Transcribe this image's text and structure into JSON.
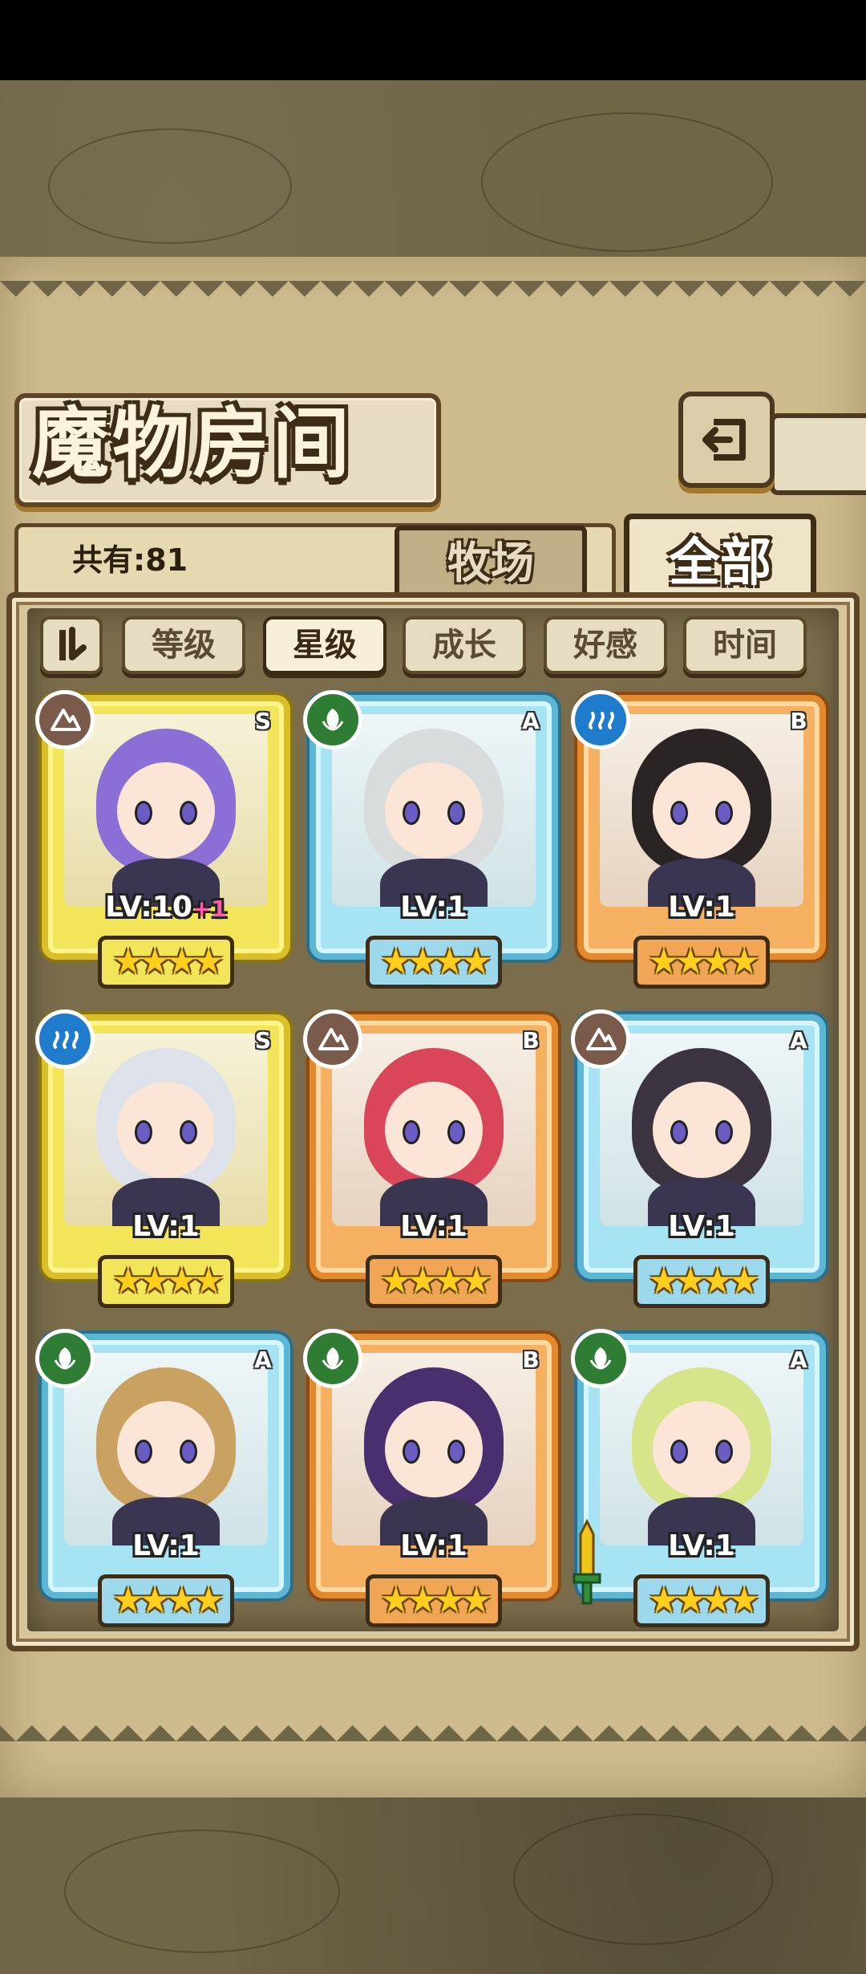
{
  "page": {
    "title": "魔物房间",
    "count_label": "共有:81",
    "tabs": [
      {
        "label": "牧场",
        "active": false
      },
      {
        "label": "全部",
        "active": true
      }
    ],
    "sort": {
      "order_icon": "sort-order-icon",
      "buttons": [
        {
          "label": "等级",
          "active": false
        },
        {
          "label": "星级",
          "active": true
        },
        {
          "label": "成长",
          "active": false
        },
        {
          "label": "好感",
          "active": false
        },
        {
          "label": "时间",
          "active": false
        }
      ]
    }
  },
  "monsters": [
    {
      "rank": "S",
      "element": "earth",
      "level": "LV:10",
      "bonus": "+1",
      "stars": "★★★★",
      "hair": "#8b6fd6"
    },
    {
      "rank": "A",
      "element": "leaf",
      "level": "LV:1",
      "bonus": "",
      "stars": "★★★★",
      "hair": "#d9dcdc"
    },
    {
      "rank": "B",
      "element": "water",
      "level": "LV:1",
      "bonus": "",
      "stars": "★★★★",
      "hair": "#2a2424"
    },
    {
      "rank": "S",
      "element": "water",
      "level": "LV:1",
      "bonus": "",
      "stars": "★★★★",
      "hair": "#dde2ea"
    },
    {
      "rank": "B",
      "element": "earth",
      "level": "LV:1",
      "bonus": "",
      "stars": "★★★★",
      "hair": "#d9465a"
    },
    {
      "rank": "A",
      "element": "earth",
      "level": "LV:1",
      "bonus": "",
      "stars": "★★★★",
      "hair": "#3b3440"
    },
    {
      "rank": "A",
      "element": "leaf",
      "level": "LV:1",
      "bonus": "",
      "stars": "★★★★",
      "hair": "#c9a261"
    },
    {
      "rank": "B",
      "element": "leaf",
      "level": "LV:1",
      "bonus": "",
      "stars": "★★★★",
      "hair": "#4a2f6e"
    },
    {
      "rank": "A",
      "element": "leaf",
      "level": "LV:1",
      "bonus": "",
      "stars": "★★★★",
      "hair": "#d6e48a"
    }
  ]
}
